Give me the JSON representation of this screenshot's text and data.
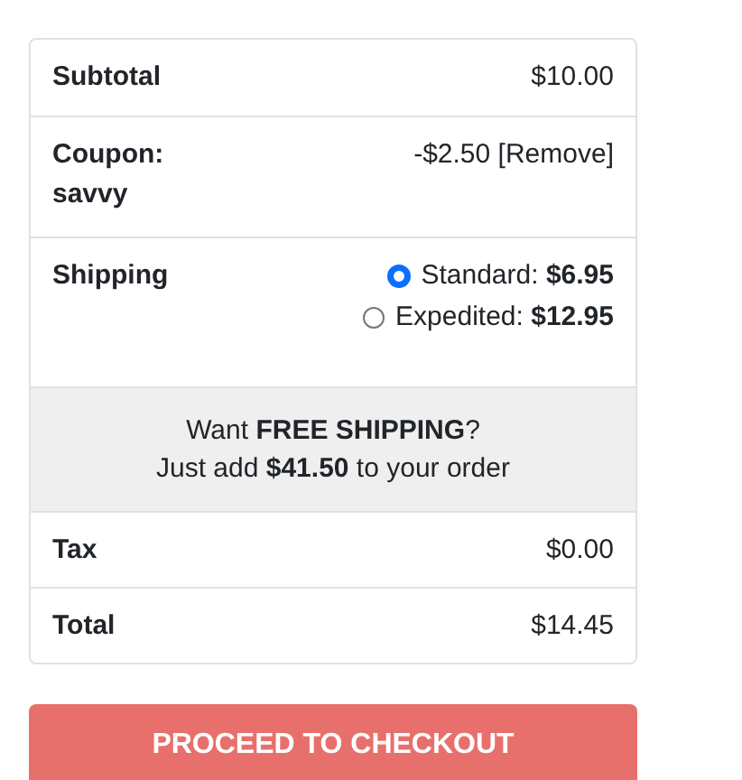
{
  "summary": [
    {
      "kind": "line",
      "label": "Subtotal",
      "value": "$10.00"
    },
    {
      "kind": "coupon",
      "label": "Coupon:",
      "code": "savvy",
      "value": "-$2.50",
      "action": "[Remove]"
    },
    {
      "kind": "shipping",
      "label": "Shipping",
      "options": [
        {
          "name": "Standard:",
          "price": "$6.95",
          "selected": true
        },
        {
          "name": "Expedited:",
          "price": "$12.95",
          "selected": false
        }
      ]
    },
    {
      "kind": "promo",
      "lines": [
        "Want **FREE SHIPPING**?",
        "Just add **$41.50** to your order"
      ]
    },
    {
      "kind": "line",
      "label": "Tax",
      "value": "$0.00"
    },
    {
      "kind": "line",
      "label": "Total",
      "value": "$14.45"
    }
  ],
  "checkout_button": "PROCEED TO CHECKOUT"
}
